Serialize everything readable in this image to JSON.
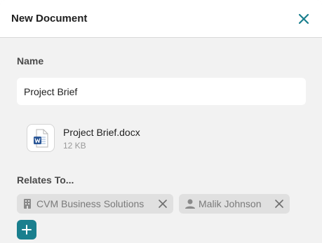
{
  "dialog": {
    "title": "New Document",
    "close_icon": "close-icon",
    "accent_color": "#1a7f8e"
  },
  "name_section": {
    "label": "Name",
    "value": "Project Brief"
  },
  "attachment": {
    "icon": "word-document-icon",
    "file_name": "Project Brief.docx",
    "file_size": "12 KB"
  },
  "relates_section": {
    "label": "Relates To...",
    "chips": [
      {
        "icon": "building-icon",
        "label": "CVM Business Solutions"
      },
      {
        "icon": "person-icon",
        "label": "Malik Johnson"
      }
    ],
    "add_icon": "plus-icon"
  }
}
